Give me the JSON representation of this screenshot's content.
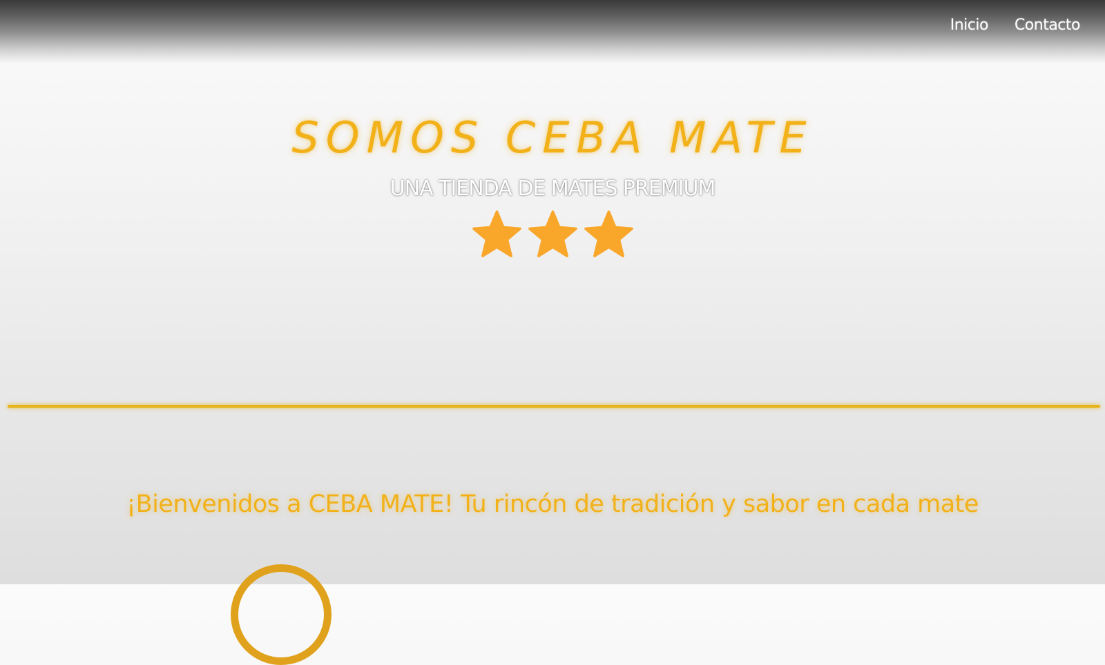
{
  "nav": {
    "items": [
      {
        "label": "Inicio"
      },
      {
        "label": "Contacto"
      }
    ]
  },
  "hero": {
    "title": "SOMOS CEBA MATE",
    "subtitle": "UNA TIENDA DE MATES PREMIUM",
    "rating": {
      "value": 3,
      "icon": "star-icon",
      "color": "#f9a72b"
    }
  },
  "welcome": {
    "text": "¡Bienvenidos a CEBA MATE! Tu rincón de tradición y sabor en cada mate"
  },
  "colors": {
    "accent": "#f2b118",
    "divider": "#e6b31a",
    "star": "#f9a72b",
    "nav_text": "#ffffff"
  }
}
